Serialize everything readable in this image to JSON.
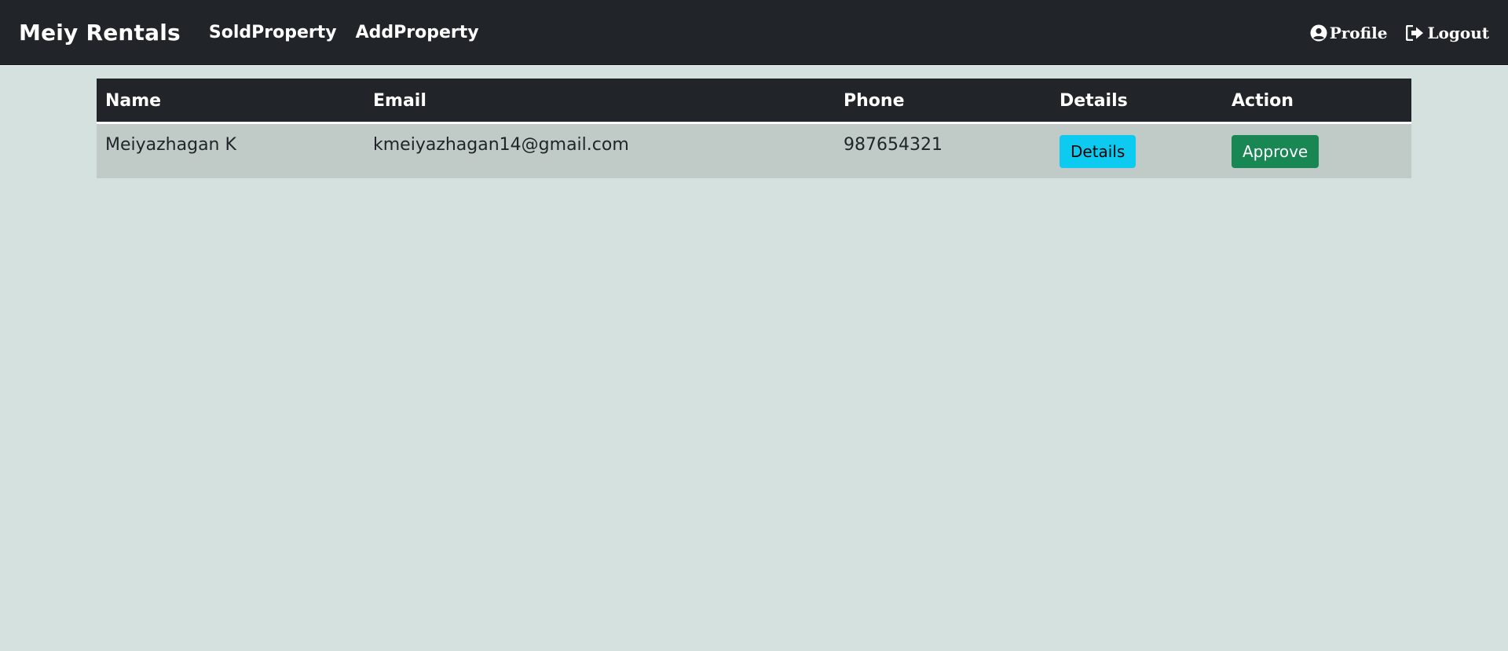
{
  "navbar": {
    "brand": "Meiy Rentals",
    "links": [
      "SoldProperty",
      "AddProperty"
    ],
    "profile_label": "Profile",
    "logout_label": "Logout"
  },
  "table": {
    "headers": [
      "Name",
      "Email",
      "Phone",
      "Details",
      "Action"
    ],
    "rows": [
      {
        "name": "Meiyazhagan K",
        "email": "kmeiyazhagan14@gmail.com",
        "phone": "987654321",
        "details_label": "Details",
        "action_label": "Approve"
      }
    ]
  },
  "icons": {
    "profile": "user-circle-icon",
    "logout": "logout-arrow-icon"
  },
  "colors": {
    "navbar_bg": "#212529",
    "page_bg": "#d4e1de",
    "row_bg": "#c0cbc8",
    "details_button": "#0dcaf0",
    "approve_button": "#198754"
  }
}
